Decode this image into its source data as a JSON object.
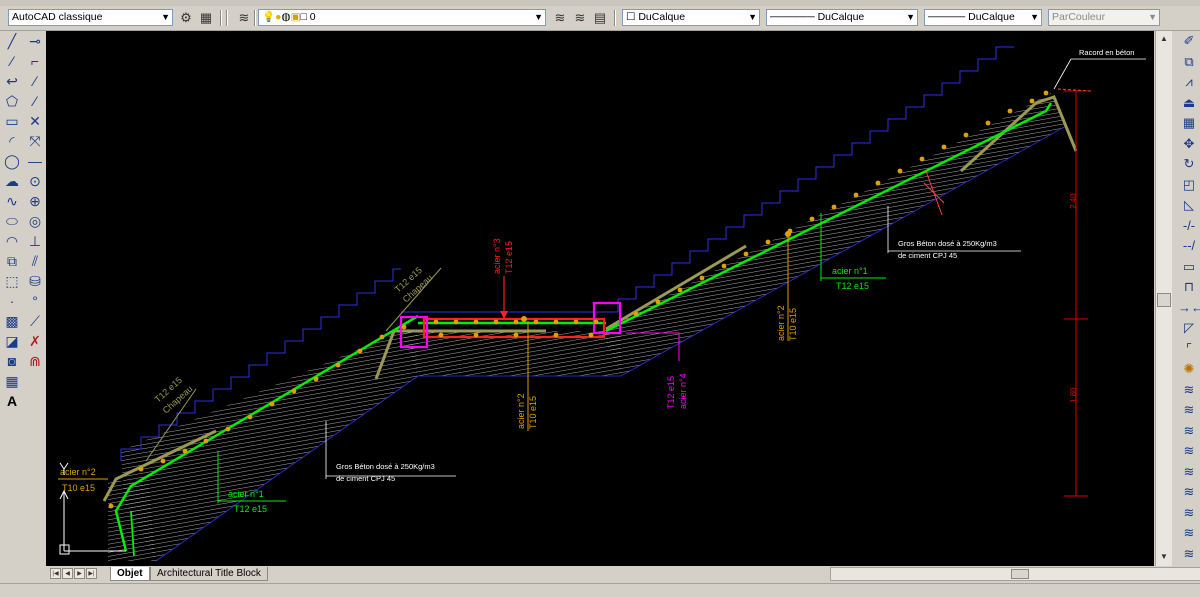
{
  "toolbar": {
    "workspace": "AutoCAD classique",
    "layer": "0",
    "color": "DuCalque",
    "linetype": "DuCalque",
    "lineweight": "DuCalque",
    "plotstyle": "ParCouleur"
  },
  "drawing": {
    "raccord": "Racord en béton",
    "gros_beton_upper_1": "Gros Béton dosé à 250Kg/m3",
    "gros_beton_upper_2": "de ciment CPJ 45",
    "gros_beton_lower_1": "Gros Béton dosé à 250Kg/m3",
    "gros_beton_lower_2": "de ciment CPJ 45",
    "acier1_right_a": "acier n°1",
    "acier1_right_b": "T12 e15",
    "acier1_left_a": "acier n°1",
    "acier1_left_b": "T12 e15",
    "acier2_left_a": "acier n°2",
    "acier2_left_b": "T10 e15",
    "acier2_mid_a": "acier n°2",
    "acier2_mid_b": "T10 e15",
    "acier2_right_a": "acier n°2",
    "acier2_right_b": "T10 e15",
    "acier3_a": "acier n°3",
    "acier3_b": "T12 e15",
    "acier4_a": "acier n°4",
    "acier4_b": "T12 e15",
    "chapeau_upper_a": "T12 e15",
    "chapeau_upper_b": "Chapeau",
    "chapeau_lower_a": "T12 e15",
    "chapeau_lower_b": "Chapeau",
    "dim_upper": "2.40",
    "dim_lower": "1.80"
  },
  "tabs": {
    "model": "Objet",
    "layout": "Architectural Title Block"
  },
  "icons": {
    "left_col1": [
      "line-icon",
      "xline-icon",
      "polyline-icon",
      "polygon-icon",
      "rectangle-icon",
      "arc-icon",
      "circle-icon",
      "revcloud-icon",
      "spline-icon",
      "ellipse-icon",
      "ellipse-arc-icon",
      "insert-block-icon",
      "make-block-icon",
      "point-icon",
      "hatch-icon",
      "gradient-icon",
      "region-icon",
      "table-icon",
      "mtext-icon"
    ],
    "left_col2": [
      "erase-icon",
      "copy-icon",
      "mirror-icon",
      "offset-icon",
      "array-icon",
      "move-icon",
      "rotate-icon",
      "scale-icon",
      "stretch-icon",
      "trim-icon",
      "extend-icon",
      "break-icon",
      "join-icon",
      "chamfer-icon",
      "fillet-icon",
      "explode-icon",
      "properties-icon",
      "matchprop-icon"
    ],
    "right_col": [
      "erase-icon",
      "copy-icon",
      "mirror-icon",
      "offset-icon",
      "array-icon",
      "move-icon",
      "rotate-icon",
      "scale-icon",
      "stretch-icon",
      "trim-icon",
      "extend-icon",
      "break-point-icon",
      "break-icon",
      "join-icon",
      "chamfer-icon",
      "fillet-icon",
      "explode-icon",
      "layer-on-icon",
      "layer-off-icon",
      "layer-iso-icon",
      "layer-freeze-icon",
      "layer-lock-icon",
      "layer-match-icon",
      "layer-walk-icon",
      "layer-merge-icon",
      "layer-delete-icon"
    ]
  }
}
